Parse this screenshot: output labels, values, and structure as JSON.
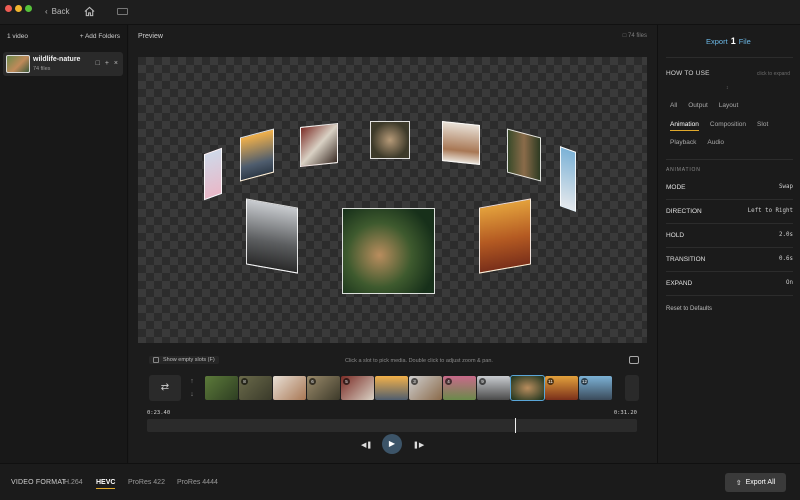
{
  "window": {
    "back_label": "Back"
  },
  "sidebar": {
    "count_label": "1 video",
    "add_folders_label": "+ Add Folders",
    "item": {
      "name": "wildlife-nature",
      "count": "74 files"
    }
  },
  "preview": {
    "title": "Preview",
    "count": "74 files",
    "show_empty_label": "Show empty slots (F)",
    "hint": "Click a slot to pick media. Double click to adjust zoom & pan.",
    "slot_numbers": [
      "",
      "8",
      "",
      "6",
      "5",
      "",
      "3",
      "4",
      "9",
      "",
      "11",
      "12"
    ],
    "selected_slot_index": 9,
    "time_start": "0:23.40",
    "time_end": "0:31.20",
    "playhead_fraction": 0.75
  },
  "right_panel": {
    "export_prefix": "Export",
    "export_count": "1",
    "export_suffix": "File",
    "how_to_use": "HOW TO USE",
    "how_to_hint": "click to expand",
    "tabs_row1": [
      "All",
      "Output",
      "Layout"
    ],
    "tabs_row2": [
      "Animation",
      "Composition",
      "Slot"
    ],
    "tabs_row3": [
      "Playback",
      "Audio"
    ],
    "active_tab": "Animation",
    "section_label": "ANIMATION",
    "props": [
      {
        "key": "MODE",
        "value": "Swap"
      },
      {
        "key": "DIRECTION",
        "value": "Left to Right"
      },
      {
        "key": "HOLD",
        "value": "2.0s"
      },
      {
        "key": "TRANSITION",
        "value": "0.6s"
      },
      {
        "key": "EXPAND",
        "value": "On"
      }
    ],
    "reset_label": "Reset to Defaults"
  },
  "bottom": {
    "video_format_label": "VIDEO FORMAT",
    "formats": [
      "H.264",
      "HEVC",
      "ProRes 422",
      "ProRes 4444"
    ],
    "active_format": "HEVC",
    "export_all_label": "Export All"
  },
  "colors": {
    "accent": "#e0a92c",
    "link_blue": "#6cb8e6",
    "play_button": "#3c5468"
  }
}
